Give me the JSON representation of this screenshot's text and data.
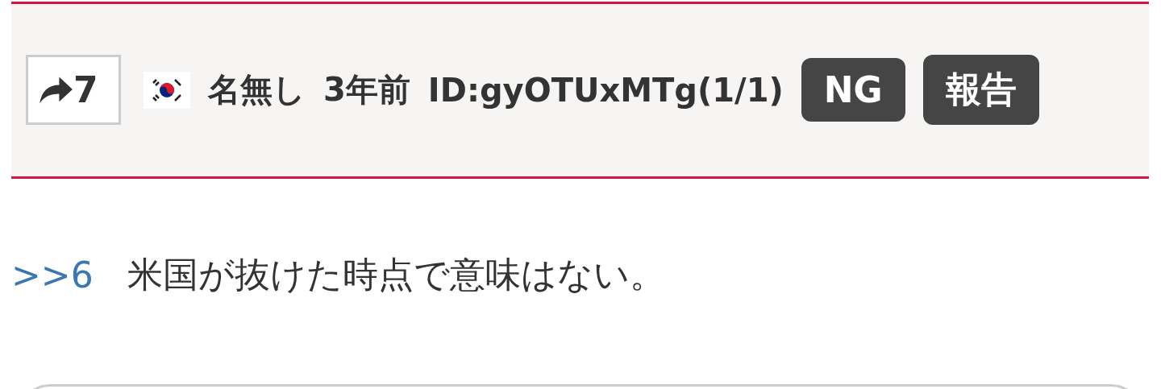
{
  "post_header": {
    "share_count": "7",
    "name": "名無し",
    "age": "3年前",
    "id": "ID:gyOTUxMTg(1/1)",
    "ng_button": "NG",
    "report_button": "報告"
  },
  "post_body": {
    "anchor": ">>6",
    "text": "米国が抜けた時点で意味はない。"
  }
}
